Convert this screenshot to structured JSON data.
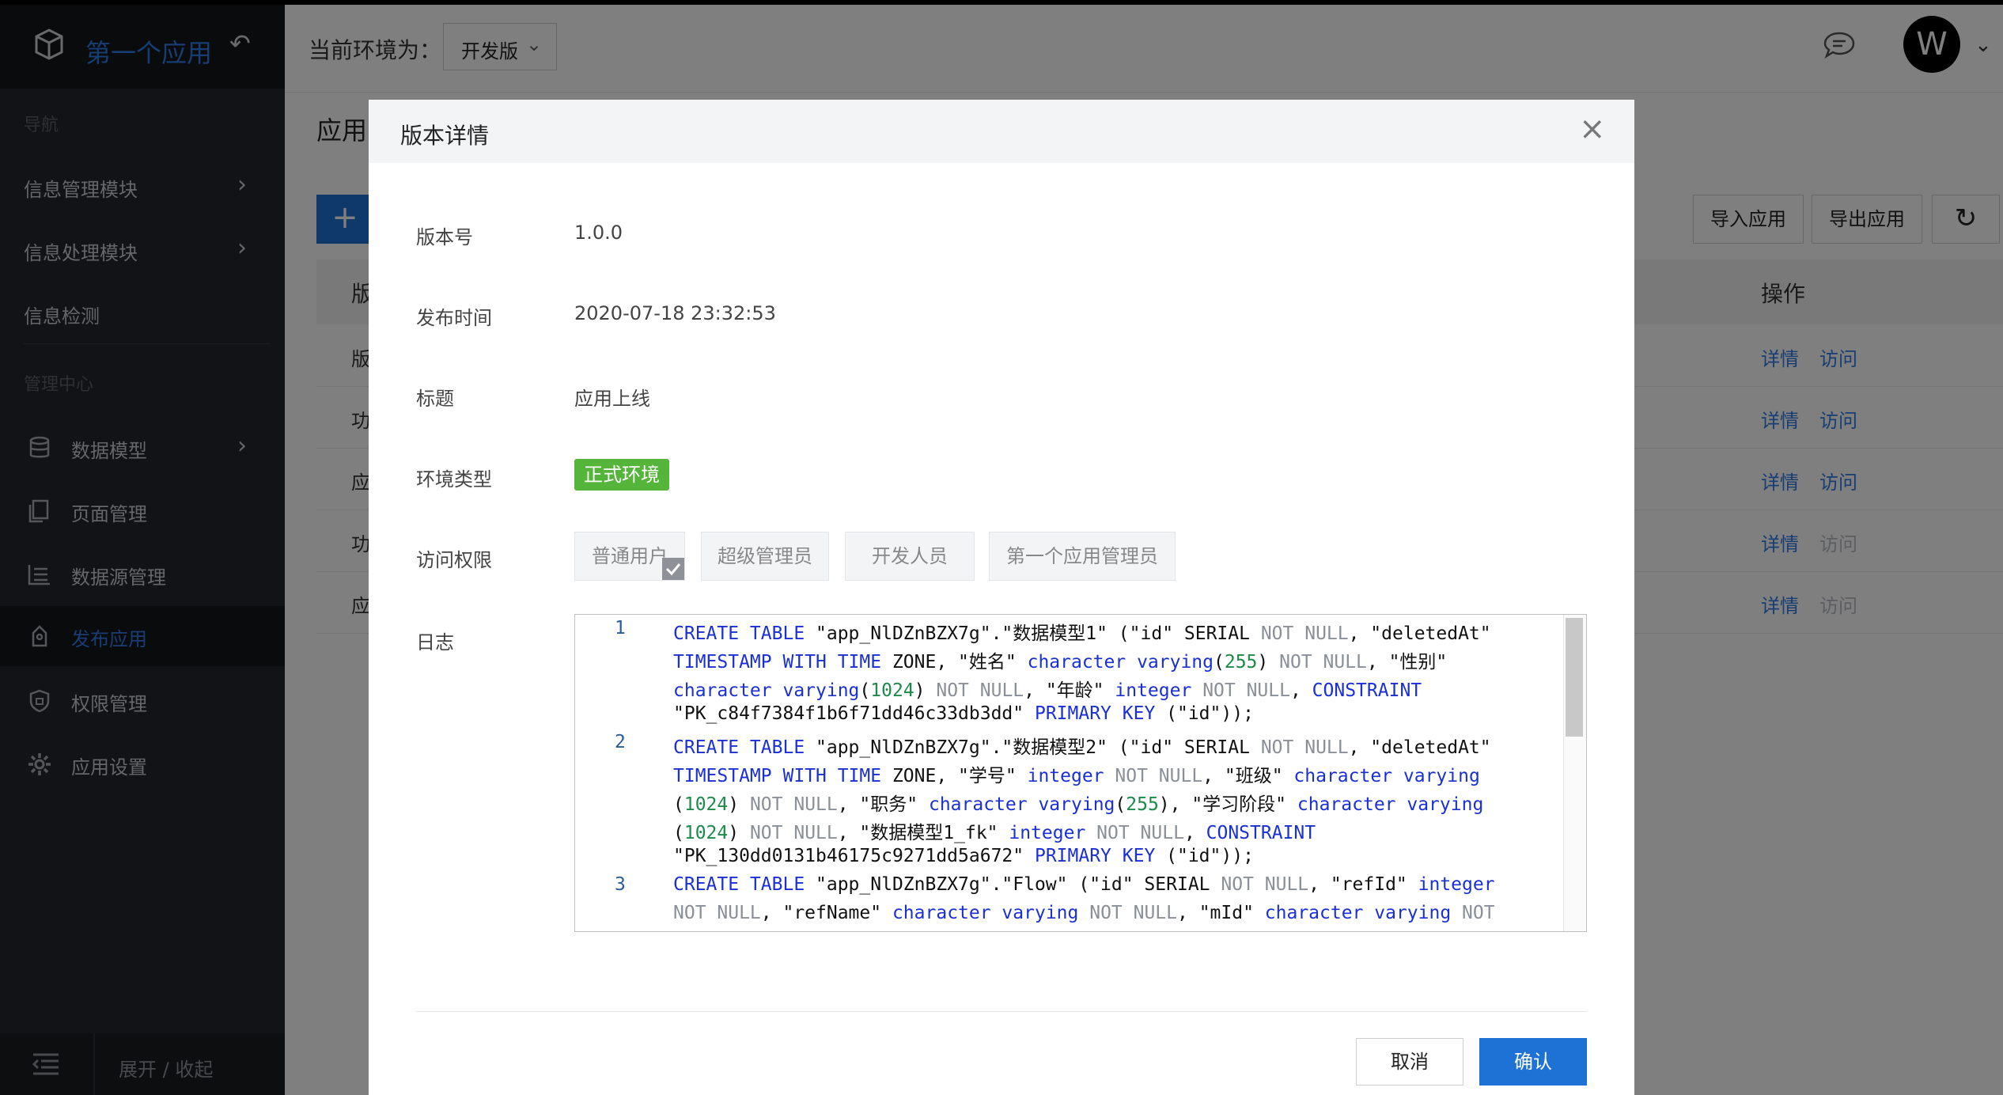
{
  "app": {
    "name": "第一个应用"
  },
  "sidebar": {
    "nav_section": "导航",
    "nav_items": [
      {
        "label": "信息管理模块",
        "has_children": true
      },
      {
        "label": "信息处理模块",
        "has_children": true
      },
      {
        "label": "信息检测",
        "has_children": false
      }
    ],
    "admin_section": "管理中心",
    "admin_items": [
      {
        "label": "数据模型",
        "icon": "database-icon",
        "has_children": true
      },
      {
        "label": "页面管理",
        "icon": "pages-icon"
      },
      {
        "label": "数据源管理",
        "icon": "datasource-icon"
      },
      {
        "label": "发布应用",
        "icon": "publish-icon",
        "active": true
      },
      {
        "label": "权限管理",
        "icon": "shield-icon"
      },
      {
        "label": "应用设置",
        "icon": "gear-icon"
      }
    ],
    "footer_label": "展开 / 收起"
  },
  "topbar": {
    "env_label": "当前环境为：",
    "env_value": "开发版",
    "avatar_letter": "W"
  },
  "main": {
    "page_title": "应用",
    "import_button": "导入应用",
    "export_button": "导出应用",
    "table": {
      "header_first": "版",
      "header_ops": "操作",
      "rows": [
        {
          "c0": "版",
          "detail": "详情",
          "visit": "访问",
          "visit_enabled": true
        },
        {
          "c0": "功",
          "detail": "详情",
          "visit": "访问",
          "visit_enabled": true
        },
        {
          "c0": "应",
          "detail": "详情",
          "visit": "访问",
          "visit_enabled": true
        },
        {
          "c0": "功",
          "detail": "详情",
          "visit": "访问",
          "visit_enabled": false
        },
        {
          "c0": "应",
          "detail": "详情",
          "visit": "访问",
          "visit_enabled": false
        }
      ]
    }
  },
  "modal": {
    "title": "版本详情",
    "fields": {
      "version_label": "版本号",
      "version_value": "1.0.0",
      "time_label": "发布时间",
      "time_value": "2020-07-18 23:32:53",
      "title_label": "标题",
      "title_value": "应用上线",
      "env_label": "环境类型",
      "env_value": "正式环境",
      "perm_label": "访问权限",
      "log_label": "日志"
    },
    "permissions": [
      {
        "label": "普通用户",
        "checked": true
      },
      {
        "label": "超级管理员",
        "checked": false
      },
      {
        "label": "开发人员",
        "checked": false
      },
      {
        "label": "第一个应用管理员",
        "checked": false
      }
    ],
    "log_lines": [
      {
        "num": "1",
        "text": "CREATE TABLE \"app_NlDZnBZX7g\".\"数据模型1\" (\"id\" SERIAL NOT NULL, \"deletedAt\" TIMESTAMP WITH TIME ZONE, \"姓名\" character varying(255) NOT NULL, \"性别\" character varying(1024) NOT NULL, \"年龄\" integer NOT NULL, CONSTRAINT \"PK_c84f7384f1b6f71dd46c33db3dd\" PRIMARY KEY (\"id\"));"
      },
      {
        "num": "2",
        "text": "CREATE TABLE \"app_NlDZnBZX7g\".\"数据模型2\" (\"id\" SERIAL NOT NULL, \"deletedAt\" TIMESTAMP WITH TIME ZONE, \"学号\" integer NOT NULL, \"班级\" character varying (1024) NOT NULL, \"职务\" character varying(255), \"学习阶段\" character varying (1024) NOT NULL, \"数据模型1_fk\" integer NOT NULL, CONSTRAINT \"PK_130dd0131b46175c9271dd5a672\" PRIMARY KEY (\"id\"));"
      },
      {
        "num": "3",
        "text": "CREATE TABLE \"app_NlDZnBZX7g\".\"Flow\" (\"id\" SERIAL NOT NULL, \"refId\" integer NOT NULL, \"refName\" character varying NOT NULL, \"mId\" character varying NOT"
      }
    ],
    "cancel": "取消",
    "confirm": "确认"
  },
  "colors": {
    "accent": "#1e72d6",
    "sidebar_bg": "#24272c",
    "env_tag": "#55b43a",
    "link": "#2f7ae6"
  }
}
